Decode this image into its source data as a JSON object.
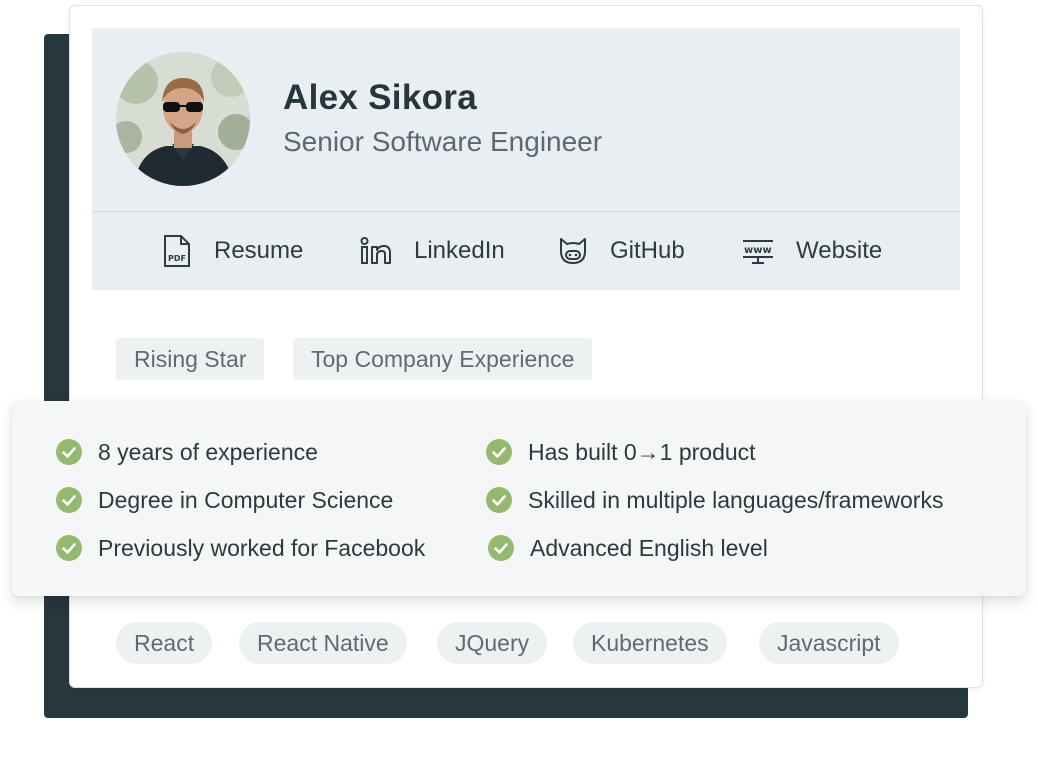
{
  "profile": {
    "name": "Alex Sikora",
    "title": "Senior Software Engineer"
  },
  "links": [
    {
      "label": "Resume",
      "icon": "pdf-file-icon"
    },
    {
      "label": "LinkedIn",
      "icon": "linkedin-icon"
    },
    {
      "label": "GitHub",
      "icon": "github-icon"
    },
    {
      "label": "Website",
      "icon": "www-monitor-icon"
    }
  ],
  "badges": [
    "Rising Star",
    "Top Company Experience"
  ],
  "highlights": {
    "left": [
      "8 years of experience",
      "Degree in Computer Science",
      "Previously worked for Facebook"
    ],
    "right": [
      "Has built 0→1 product",
      "Skilled in multiple languages/frameworks",
      "Advanced English level"
    ]
  },
  "skills": [
    "React",
    "React Native",
    "JQuery",
    "Kubernetes",
    "Javascript"
  ],
  "colors": {
    "header_bg": "#e8eef1",
    "back_card": "#26373d",
    "check_green": "#95b96e",
    "tag_bg": "#eef1f2"
  }
}
